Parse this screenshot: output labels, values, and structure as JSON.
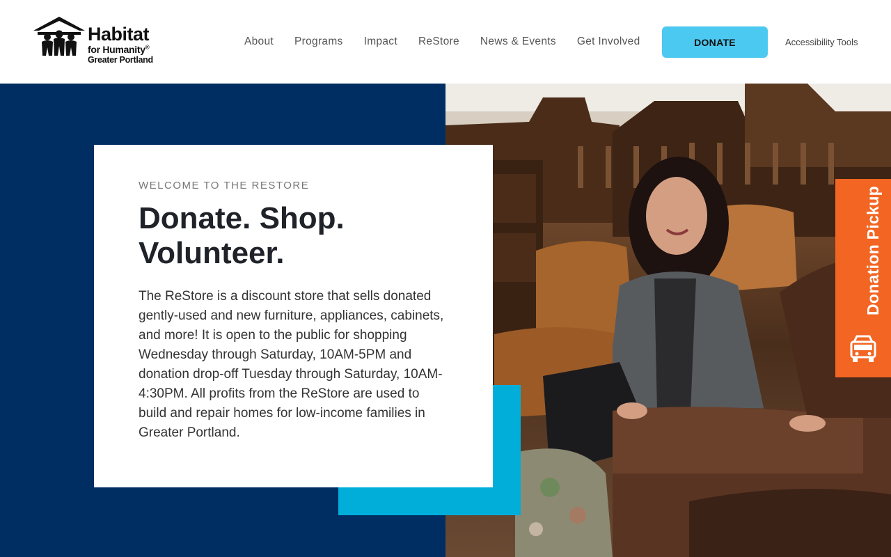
{
  "brand": {
    "title": "Habitat",
    "subtitle": "for Humanity",
    "registered": "®",
    "region": "Greater Portland"
  },
  "nav": {
    "items": [
      {
        "label": "About"
      },
      {
        "label": "Programs"
      },
      {
        "label": "Impact"
      },
      {
        "label": "ReStore"
      },
      {
        "label": "News & Events"
      },
      {
        "label": "Get Involved"
      }
    ],
    "donate_label": "DONATE",
    "accessibility_label": "Accessibility Tools"
  },
  "hero": {
    "eyebrow": "WELCOME TO THE RESTORE",
    "headline_line1": "Donate. Shop.",
    "headline_line2": "Volunteer.",
    "body": "The ReStore is a discount store that sells donated gently-used and new furniture, appliances, cabinets, and more! It is open to the public for shopping Wednesday through Saturday, 10AM-5PM and donation drop-off Tuesday through Saturday, 10AM-4:30PM. All profits from the ReStore are used to build and repair homes for low-income families in Greater Portland."
  },
  "pickup": {
    "label": "Donation Pickup",
    "icon": "truck-icon"
  },
  "colors": {
    "navy": "#002d62",
    "accent_blue": "#00aed9",
    "donate_button": "#4cc9f0",
    "pickup_orange": "#f26522"
  }
}
